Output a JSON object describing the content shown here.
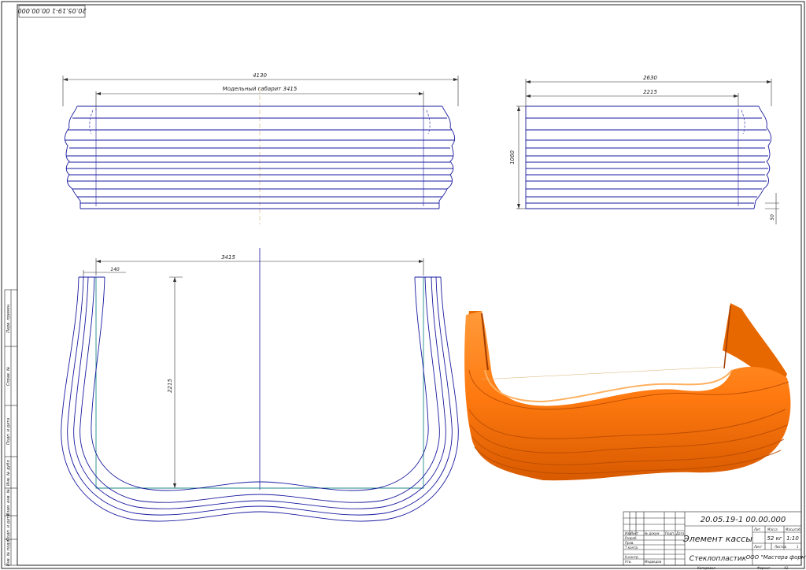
{
  "drawing_code_stamp": "20.05.19-1 00.00.000",
  "front_view": {
    "overall_width": "4130",
    "model_size_label": "Модельный габарит 3415"
  },
  "side_view": {
    "overall_width": "2630",
    "inner_width": "2215",
    "height": "1060",
    "bottom_offset": "50"
  },
  "plan_view": {
    "width": "3415",
    "wall": "140",
    "depth": "2215"
  },
  "side_stamp": {
    "perv_primen": "Перв. примен.",
    "sprav": "Справ. №",
    "podp_data_1": "Подп. и дата",
    "inv_dubl": "Инв. № дубл.",
    "vzam_inv": "Взам. инв. №",
    "podp_data_2": "Подп. и дата",
    "inv_podl": "Инв. № подл."
  },
  "title_block": {
    "code": "20.05.19-1 00.00.000",
    "name": "Элемент кассы",
    "material": "Стеклопластик",
    "organization": "ООО \"Мастера форм\"",
    "mass": "52 кг",
    "scale": "1:10",
    "sheet_label": "Лист",
    "sheets_label": "Листов",
    "sheets_count": "1",
    "lit_label": "Лит.",
    "mass_label": "Масса",
    "scale_label": "Масштаб",
    "izm": "Изм.",
    "list": "Лист",
    "doc_no": "№ докум.",
    "podp": "Подп.",
    "data": "Дата",
    "razrab": "Разраб.",
    "prov": "Пров.",
    "t_kontr": "Т.контр.",
    "n_kontr": "Н.контр.",
    "utv": "Утв.",
    "utv_name": "Медведев",
    "copied": "Копировал",
    "format_label": "Формат",
    "format": "А1"
  },
  "colors": {
    "linework": "#1a1aa0",
    "render_orange": "#ff7a10",
    "render_dark": "#d85a00",
    "highlight": "#ffa54a",
    "plan_inner": "#1f8a8a"
  }
}
